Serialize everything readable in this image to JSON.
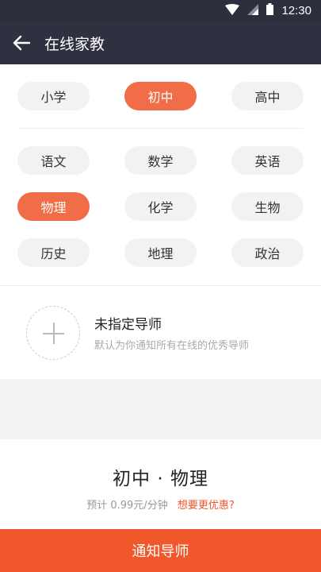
{
  "status_bar": {
    "time": "12:30"
  },
  "toolbar": {
    "title": "在线家教"
  },
  "grades": [
    {
      "label": "小学",
      "active": false
    },
    {
      "label": "初中",
      "active": true
    },
    {
      "label": "高中",
      "active": false
    }
  ],
  "subjects": [
    {
      "label": "语文",
      "active": false
    },
    {
      "label": "数学",
      "active": false
    },
    {
      "label": "英语",
      "active": false
    },
    {
      "label": "物理",
      "active": true
    },
    {
      "label": "化学",
      "active": false
    },
    {
      "label": "生物",
      "active": false
    },
    {
      "label": "历史",
      "active": false
    },
    {
      "label": "地理",
      "active": false
    },
    {
      "label": "政治",
      "active": false
    }
  ],
  "teacher": {
    "name": "未指定导师",
    "description": "默认为你通知所有在线的优秀导师"
  },
  "summary": {
    "title": "初中 · 物理",
    "price": "预计 0.99元/分钟",
    "discount_link": "想要更优惠?"
  },
  "notify_button": {
    "label": "通知导师"
  },
  "colors": {
    "accent": "#f06d47",
    "button": "#f0572a",
    "toolbar": "#2f3140"
  }
}
